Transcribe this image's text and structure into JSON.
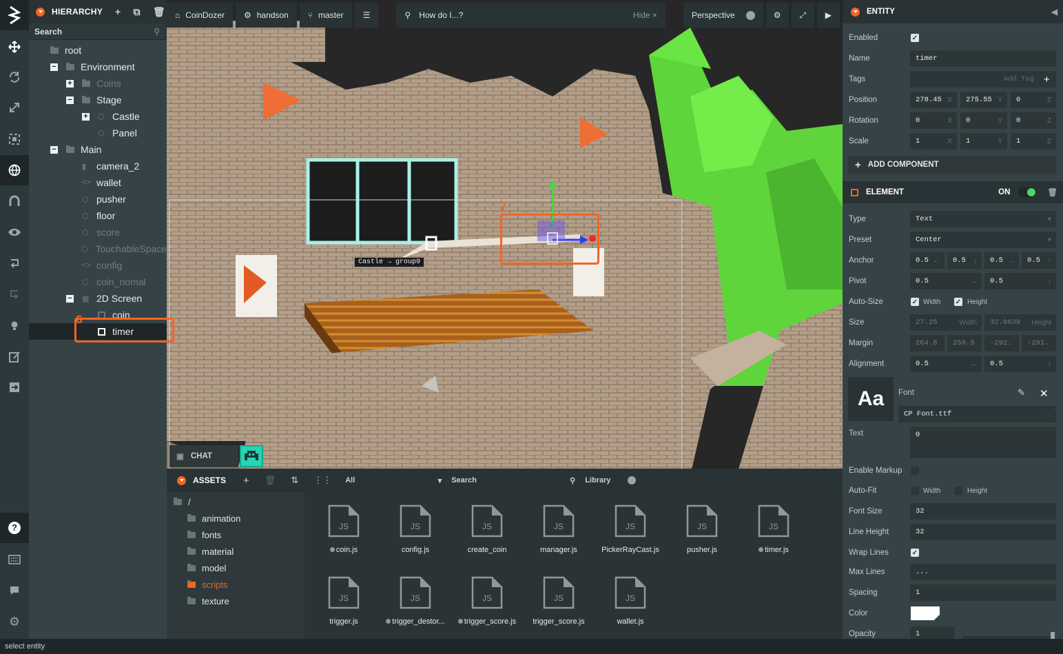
{
  "toolbar": {
    "items": [
      "logo-icon",
      "move-icon",
      "rotate-icon",
      "scale-icon",
      "resize-icon",
      "globe-icon",
      "magnet-icon",
      "eye-icon",
      "undo-icon",
      "redo-icon",
      "light-icon",
      "edit-icon",
      "publish-icon",
      "help-icon",
      "keyboard-icon",
      "chat-icon",
      "settings-icon"
    ]
  },
  "hierarchy": {
    "title": "HIERARCHY",
    "search_placeholder": "Search",
    "items": [
      {
        "label": "root",
        "depth": 0,
        "toggle": "",
        "dim": false,
        "icon": "folder"
      },
      {
        "label": "Environment",
        "depth": 1,
        "toggle": "−",
        "dim": false,
        "icon": "folder"
      },
      {
        "label": "Coins",
        "depth": 2,
        "toggle": "+",
        "dim": true,
        "icon": "folder"
      },
      {
        "label": "Stage",
        "depth": 2,
        "toggle": "−",
        "dim": false,
        "icon": "folder"
      },
      {
        "label": "Castle",
        "depth": 3,
        "toggle": "+",
        "dim": false,
        "icon": "entity"
      },
      {
        "label": "Panel",
        "depth": 3,
        "toggle": "",
        "dim": false,
        "icon": "entity"
      },
      {
        "label": "Main",
        "depth": 1,
        "toggle": "−",
        "dim": false,
        "icon": "folder"
      },
      {
        "label": "camera_2",
        "depth": 2,
        "toggle": "",
        "dim": false,
        "icon": "camera"
      },
      {
        "label": "wallet",
        "depth": 2,
        "toggle": "",
        "dim": false,
        "icon": "script"
      },
      {
        "label": "pusher",
        "depth": 2,
        "toggle": "",
        "dim": false,
        "icon": "entity"
      },
      {
        "label": "floor",
        "depth": 2,
        "toggle": "",
        "dim": false,
        "icon": "entity"
      },
      {
        "label": "score",
        "depth": 2,
        "toggle": "",
        "dim": true,
        "icon": "entity"
      },
      {
        "label": "TouchableSpace",
        "depth": 2,
        "toggle": "",
        "dim": true,
        "icon": "entity"
      },
      {
        "label": "config",
        "depth": 2,
        "toggle": "",
        "dim": true,
        "icon": "script"
      },
      {
        "label": "coin_nomal",
        "depth": 2,
        "toggle": "",
        "dim": true,
        "icon": "entity"
      },
      {
        "label": "2D Screen",
        "depth": 2,
        "toggle": "−",
        "dim": false,
        "icon": "screen"
      },
      {
        "label": "coin",
        "depth": 3,
        "toggle": "",
        "dim": false,
        "icon": "element"
      },
      {
        "label": "timer",
        "depth": 3,
        "toggle": "",
        "dim": false,
        "icon": "element",
        "selected": true
      }
    ]
  },
  "topbar": {
    "project": "CoinDozer",
    "user": "handson",
    "branch": "master",
    "search_placeholder": "How do I...?",
    "hide_label": "Hide",
    "camera": "Perspective"
  },
  "viewport": {
    "label_castle": "Castle → group9",
    "callout_6": "6",
    "callout_7": "7",
    "chat_label": "CHAT"
  },
  "entity": {
    "title": "ENTITY",
    "enabled_label": "Enabled",
    "name_label": "Name",
    "name_value": "timer",
    "tags_label": "Tags",
    "tags_placeholder": "Add Tag",
    "position_label": "Position",
    "position": [
      "278.45",
      "275.55",
      "0"
    ],
    "rotation_label": "Rotation",
    "rotation": [
      "0",
      "0",
      "0"
    ],
    "scale_label": "Scale",
    "scale": [
      "1",
      "1",
      "1"
    ],
    "add_component": "ADD COMPONENT"
  },
  "element": {
    "title": "ELEMENT",
    "on_label": "ON",
    "type_label": "Type",
    "type_value": "Text",
    "preset_label": "Preset",
    "preset_value": "Center",
    "anchor_label": "Anchor",
    "anchor": [
      "0.5",
      "0.5",
      "0.5",
      "0.5"
    ],
    "pivot_label": "Pivot",
    "pivot": [
      "0.5",
      "0.5"
    ],
    "autosize_label": "Auto-Size",
    "width_label": "Width",
    "height_label": "Height",
    "size_label": "Size",
    "size": [
      "27.25",
      "32.0639"
    ],
    "margin_label": "Margin",
    "margin": [
      "264.8",
      "259.5",
      "-292.",
      "-291."
    ],
    "alignment_label": "Alignment",
    "alignment": [
      "0.5",
      "0.5"
    ],
    "font_label": "Font",
    "font_preview": "Aa",
    "font_value": "CP Font.ttf",
    "font_more": "...",
    "text_label": "Text",
    "text_value": "0",
    "markup_label": "Enable Markup",
    "autofit_label": "Auto-Fit",
    "fontsize_label": "Font Size",
    "fontsize_value": "32",
    "lineheight_label": "Line Height",
    "lineheight_value": "32",
    "wrap_label": "Wrap Lines",
    "maxlines_label": "Max Lines",
    "maxlines_value": "...",
    "spacing_label": "Spacing",
    "spacing_value": "1",
    "color_label": "Color",
    "opacity_label": "Opacity",
    "opacity_value": "1",
    "color_value": "#ffffff"
  },
  "assets": {
    "title": "ASSETS",
    "filter": "All",
    "search_placeholder": "Search",
    "library_label": "Library",
    "root": "/",
    "folders": [
      "animation",
      "fonts",
      "material",
      "model",
      "scripts",
      "texture"
    ],
    "active_folder": "scripts",
    "files": [
      {
        "name": "coin.js",
        "dot": true
      },
      {
        "name": "config.js",
        "dot": false
      },
      {
        "name": "create_coin",
        "dot": false
      },
      {
        "name": "manager.js",
        "dot": false
      },
      {
        "name": "PickerRayCast.js",
        "dot": false
      },
      {
        "name": "pusher.js",
        "dot": false
      },
      {
        "name": "timer.js",
        "dot": true
      },
      {
        "name": "trigger.js",
        "dot": false
      },
      {
        "name": "trigger_destor...",
        "dot": true
      },
      {
        "name": "trigger_score.js",
        "dot": true
      },
      {
        "name": "trigger_score.js",
        "dot": false
      },
      {
        "name": "wallet.js",
        "dot": false
      }
    ],
    "file_badge": "JS"
  },
  "status": {
    "text": "select entity"
  },
  "colors": {
    "accent": "#f26522",
    "panel": "#364346",
    "dark": "#293234"
  }
}
